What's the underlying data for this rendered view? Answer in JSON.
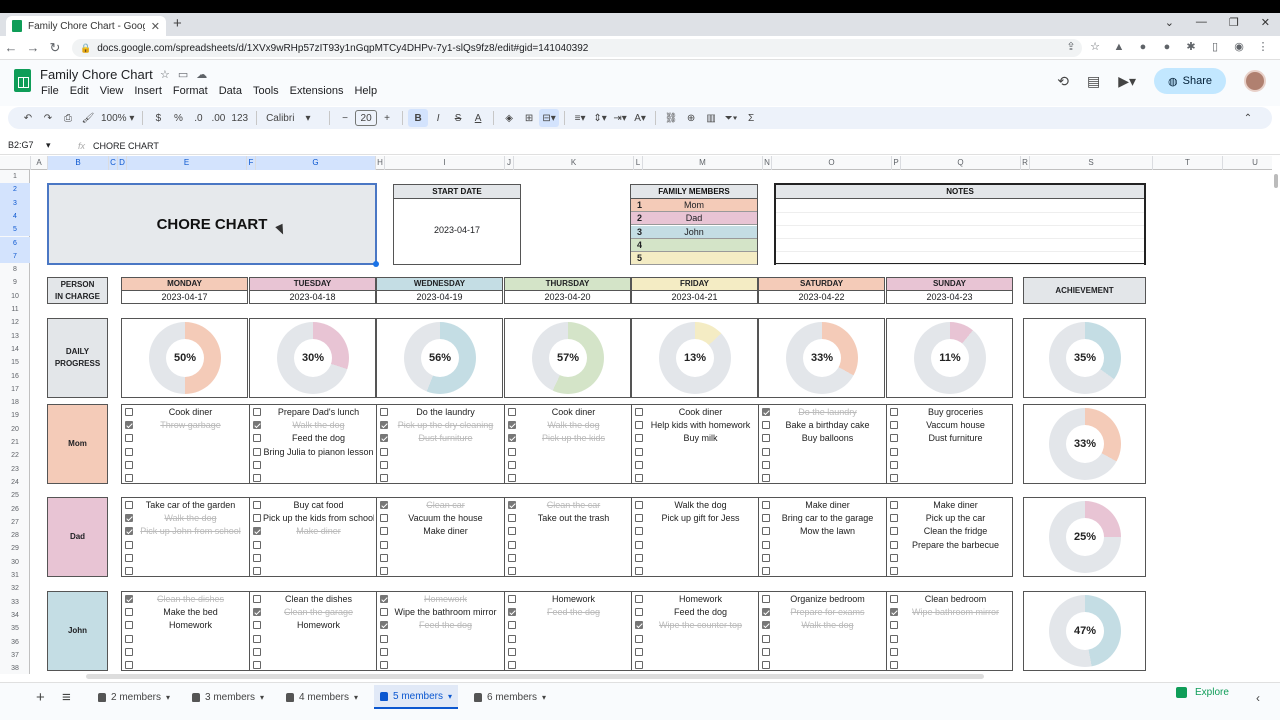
{
  "browser": {
    "tab_title": "Family Chore Chart - Google She",
    "url": "docs.google.com/spreadsheets/d/1XVx9wRHp57zIT93y1nGqpMTCy4DHPv-7y1-slQs9fz8/edit#gid=141040392"
  },
  "app": {
    "doc_title": "Family Chore Chart",
    "menus": [
      "File",
      "Edit",
      "View",
      "Insert",
      "Format",
      "Data",
      "Tools",
      "Extensions",
      "Help"
    ],
    "share_label": "Share"
  },
  "toolbar": {
    "zoom": "100%",
    "currency": "$",
    "percent": "%",
    "dec_dec": ".0",
    "dec_inc": ".00",
    "num_fmt": "123",
    "font": "Calibri",
    "font_size": "20",
    "bold": "B",
    "italic": "I"
  },
  "formula": {
    "name_box": "B2:G7",
    "fx": "fx",
    "content": "CHORE CHART"
  },
  "columns": [
    "A",
    "B",
    "C",
    "D",
    "E",
    "F",
    "G",
    "H",
    "I",
    "J",
    "K",
    "L",
    "M",
    "N",
    "O",
    "P",
    "Q",
    "R",
    "S",
    "T",
    "U"
  ],
  "rows": [
    "1",
    "2",
    "3",
    "4",
    "5",
    "6",
    "7",
    "8",
    "9",
    "10",
    "11",
    "12",
    "13",
    "14",
    "15",
    "16",
    "17",
    "18",
    "19",
    "20",
    "21",
    "22",
    "23",
    "24",
    "25",
    "26",
    "27",
    "28",
    "29",
    "30",
    "31",
    "32",
    "33",
    "34",
    "35",
    "36",
    "37",
    "38"
  ],
  "sheet": {
    "title": "CHORE CHART",
    "start_date_label": "START DATE",
    "start_date": "2023-04-17",
    "family_label": "FAMILY MEMBERS",
    "family": [
      {
        "num": "1",
        "name": "Mom",
        "color": "#f4cbb8"
      },
      {
        "num": "2",
        "name": "Dad",
        "color": "#e8c4d4"
      },
      {
        "num": "3",
        "name": "John",
        "color": "#c4dde4"
      },
      {
        "num": "4",
        "name": "",
        "color": "#d4e4c8"
      },
      {
        "num": "5",
        "name": "",
        "color": "#f4ecc4"
      }
    ],
    "notes_label": "NOTES",
    "person_label_1": "PERSON",
    "person_label_2": "IN CHARGE",
    "achievement_label": "ACHIEVEMENT",
    "daily_progress_label_1": "DAILY",
    "daily_progress_label_2": "PROGRESS",
    "days": [
      {
        "name": "MONDAY",
        "date": "2023-04-17",
        "color": "#f4cbb8",
        "progress": "50%",
        "value": 50
      },
      {
        "name": "TUESDAY",
        "date": "2023-04-18",
        "color": "#e8c4d4",
        "progress": "30%",
        "value": 30
      },
      {
        "name": "WEDNESDAY",
        "date": "2023-04-19",
        "color": "#c4dde4",
        "progress": "56%",
        "value": 56
      },
      {
        "name": "THURSDAY",
        "date": "2023-04-20",
        "color": "#d4e4c8",
        "progress": "57%",
        "value": 57
      },
      {
        "name": "FRIDAY",
        "date": "2023-04-21",
        "color": "#f4ecc4",
        "progress": "13%",
        "value": 13
      },
      {
        "name": "SATURDAY",
        "date": "2023-04-22",
        "color": "#f4cbb8",
        "progress": "33%",
        "value": 33
      },
      {
        "name": "SUNDAY",
        "date": "2023-04-23",
        "color": "#e8c4d4",
        "progress": "11%",
        "value": 11
      }
    ],
    "achievement": {
      "progress": "35%",
      "value": 35,
      "color": "#c4dde4"
    },
    "people": [
      {
        "name": "Mom",
        "color": "#f4cbb8",
        "achievement": "33%",
        "value": 33,
        "tasks": [
          [
            [
              "Cook diner",
              false
            ],
            [
              "Throw garbage",
              true
            ]
          ],
          [
            [
              "Prepare Dad's lunch",
              false
            ],
            [
              "Walk the dog",
              true
            ],
            [
              "Feed the dog",
              false
            ],
            [
              "Bring Julia to pianon lesson",
              false
            ]
          ],
          [
            [
              "Do the laundry",
              false
            ],
            [
              "Pick up the dry cleaning",
              true
            ],
            [
              "Dust furniture",
              true
            ]
          ],
          [
            [
              "Cook diner",
              false
            ],
            [
              "Walk the dog",
              true
            ],
            [
              "Pick up the kids",
              true
            ]
          ],
          [
            [
              "Cook diner",
              false
            ],
            [
              "Help kids with homework",
              false
            ],
            [
              "Buy milk",
              false
            ]
          ],
          [
            [
              "Do the laundry",
              true
            ],
            [
              "Bake a birthday cake",
              false
            ],
            [
              "Buy balloons",
              false
            ]
          ],
          [
            [
              "Buy groceries",
              false
            ],
            [
              "Vaccum house",
              false
            ],
            [
              "Dust furniture",
              false
            ]
          ]
        ]
      },
      {
        "name": "Dad",
        "color": "#e8c4d4",
        "achievement": "25%",
        "value": 25,
        "tasks": [
          [
            [
              "Take car of the garden",
              false
            ],
            [
              "Walk the dog",
              true
            ],
            [
              "Pick up John from school",
              true
            ]
          ],
          [
            [
              "Buy cat food",
              false
            ],
            [
              "Pick up the kids from school",
              false
            ],
            [
              "Make diner",
              true
            ]
          ],
          [
            [
              "Clean car",
              true
            ],
            [
              "Vacuum the house",
              false
            ],
            [
              "Make diner",
              false
            ]
          ],
          [
            [
              "Clean the car",
              true
            ],
            [
              "Take out the trash",
              false
            ]
          ],
          [
            [
              "Walk the dog",
              false
            ],
            [
              "Pick up gift for Jess",
              false
            ]
          ],
          [
            [
              "Make diner",
              false
            ],
            [
              "Bring car to the garage",
              false
            ],
            [
              "Mow the lawn",
              false
            ]
          ],
          [
            [
              "Make diner",
              false
            ],
            [
              "Pick up the car",
              false
            ],
            [
              "Clean the fridge",
              false
            ],
            [
              "Prepare the barbecue",
              false
            ]
          ]
        ]
      },
      {
        "name": "John",
        "color": "#c4dde4",
        "achievement": "47%",
        "value": 47,
        "tasks": [
          [
            [
              "Clean the dishes",
              true
            ],
            [
              "Make the bed",
              false
            ],
            [
              "Homework",
              false
            ]
          ],
          [
            [
              "Clean the dishes",
              false
            ],
            [
              "Clean the garage",
              true
            ],
            [
              "Homework",
              false
            ]
          ],
          [
            [
              "Homework",
              true
            ],
            [
              "Wipe the bathroom mirror",
              false
            ],
            [
              "Feed the dog",
              true
            ]
          ],
          [
            [
              "Homework",
              false
            ],
            [
              "Feed the dog",
              true
            ]
          ],
          [
            [
              "Homework",
              false
            ],
            [
              "Feed the dog",
              false
            ],
            [
              "Wipe the counter top",
              true
            ]
          ],
          [
            [
              "Organize bedroom",
              false
            ],
            [
              "Prepare for exams",
              true
            ],
            [
              "Walk the dog",
              true
            ]
          ],
          [
            [
              "Clean bedroom",
              false
            ],
            [
              "Wipe bathroom mirror",
              true
            ]
          ]
        ]
      }
    ]
  },
  "sheet_tabs": [
    {
      "label": "2 members",
      "active": false
    },
    {
      "label": "3 members",
      "active": false
    },
    {
      "label": "4 members",
      "active": false
    },
    {
      "label": "5 members",
      "active": true
    },
    {
      "label": "6 members",
      "active": false
    }
  ],
  "explore_label": "Explore"
}
